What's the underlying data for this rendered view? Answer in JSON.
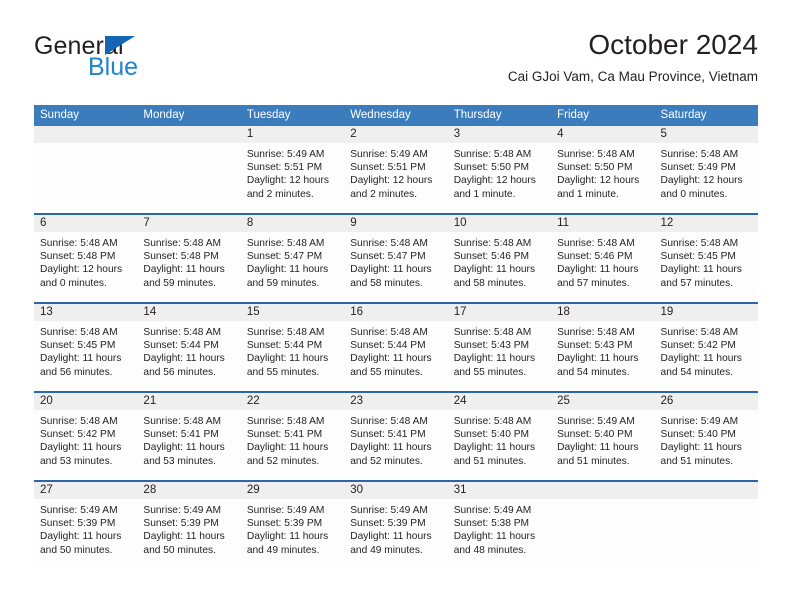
{
  "brand": {
    "line1": "General",
    "line2": "Blue",
    "triangle_color": "#1565b5",
    "blue_color": "#2283c8"
  },
  "header": {
    "title": "October 2024",
    "subtitle": "Cai GJoi Vam, Ca Mau Province, Vietnam"
  },
  "theme": {
    "header_row_bg": "#3b7cbd",
    "week_divider": "#2c68a8",
    "day_head_bg": "#efefef",
    "cell_bg": "#fdfdfd"
  },
  "weekdays": [
    "Sunday",
    "Monday",
    "Tuesday",
    "Wednesday",
    "Thursday",
    "Friday",
    "Saturday"
  ],
  "weeks": [
    [
      {
        "day": "",
        "lines": []
      },
      {
        "day": "",
        "lines": []
      },
      {
        "day": "1",
        "lines": [
          "Sunrise: 5:49 AM",
          "Sunset: 5:51 PM",
          "Daylight: 12 hours",
          "and 2 minutes."
        ]
      },
      {
        "day": "2",
        "lines": [
          "Sunrise: 5:49 AM",
          "Sunset: 5:51 PM",
          "Daylight: 12 hours",
          "and 2 minutes."
        ]
      },
      {
        "day": "3",
        "lines": [
          "Sunrise: 5:48 AM",
          "Sunset: 5:50 PM",
          "Daylight: 12 hours",
          "and 1 minute."
        ]
      },
      {
        "day": "4",
        "lines": [
          "Sunrise: 5:48 AM",
          "Sunset: 5:50 PM",
          "Daylight: 12 hours",
          "and 1 minute."
        ]
      },
      {
        "day": "5",
        "lines": [
          "Sunrise: 5:48 AM",
          "Sunset: 5:49 PM",
          "Daylight: 12 hours",
          "and 0 minutes."
        ]
      }
    ],
    [
      {
        "day": "6",
        "lines": [
          "Sunrise: 5:48 AM",
          "Sunset: 5:48 PM",
          "Daylight: 12 hours",
          "and 0 minutes."
        ]
      },
      {
        "day": "7",
        "lines": [
          "Sunrise: 5:48 AM",
          "Sunset: 5:48 PM",
          "Daylight: 11 hours",
          "and 59 minutes."
        ]
      },
      {
        "day": "8",
        "lines": [
          "Sunrise: 5:48 AM",
          "Sunset: 5:47 PM",
          "Daylight: 11 hours",
          "and 59 minutes."
        ]
      },
      {
        "day": "9",
        "lines": [
          "Sunrise: 5:48 AM",
          "Sunset: 5:47 PM",
          "Daylight: 11 hours",
          "and 58 minutes."
        ]
      },
      {
        "day": "10",
        "lines": [
          "Sunrise: 5:48 AM",
          "Sunset: 5:46 PM",
          "Daylight: 11 hours",
          "and 58 minutes."
        ]
      },
      {
        "day": "11",
        "lines": [
          "Sunrise: 5:48 AM",
          "Sunset: 5:46 PM",
          "Daylight: 11 hours",
          "and 57 minutes."
        ]
      },
      {
        "day": "12",
        "lines": [
          "Sunrise: 5:48 AM",
          "Sunset: 5:45 PM",
          "Daylight: 11 hours",
          "and 57 minutes."
        ]
      }
    ],
    [
      {
        "day": "13",
        "lines": [
          "Sunrise: 5:48 AM",
          "Sunset: 5:45 PM",
          "Daylight: 11 hours",
          "and 56 minutes."
        ]
      },
      {
        "day": "14",
        "lines": [
          "Sunrise: 5:48 AM",
          "Sunset: 5:44 PM",
          "Daylight: 11 hours",
          "and 56 minutes."
        ]
      },
      {
        "day": "15",
        "lines": [
          "Sunrise: 5:48 AM",
          "Sunset: 5:44 PM",
          "Daylight: 11 hours",
          "and 55 minutes."
        ]
      },
      {
        "day": "16",
        "lines": [
          "Sunrise: 5:48 AM",
          "Sunset: 5:44 PM",
          "Daylight: 11 hours",
          "and 55 minutes."
        ]
      },
      {
        "day": "17",
        "lines": [
          "Sunrise: 5:48 AM",
          "Sunset: 5:43 PM",
          "Daylight: 11 hours",
          "and 55 minutes."
        ]
      },
      {
        "day": "18",
        "lines": [
          "Sunrise: 5:48 AM",
          "Sunset: 5:43 PM",
          "Daylight: 11 hours",
          "and 54 minutes."
        ]
      },
      {
        "day": "19",
        "lines": [
          "Sunrise: 5:48 AM",
          "Sunset: 5:42 PM",
          "Daylight: 11 hours",
          "and 54 minutes."
        ]
      }
    ],
    [
      {
        "day": "20",
        "lines": [
          "Sunrise: 5:48 AM",
          "Sunset: 5:42 PM",
          "Daylight: 11 hours",
          "and 53 minutes."
        ]
      },
      {
        "day": "21",
        "lines": [
          "Sunrise: 5:48 AM",
          "Sunset: 5:41 PM",
          "Daylight: 11 hours",
          "and 53 minutes."
        ]
      },
      {
        "day": "22",
        "lines": [
          "Sunrise: 5:48 AM",
          "Sunset: 5:41 PM",
          "Daylight: 11 hours",
          "and 52 minutes."
        ]
      },
      {
        "day": "23",
        "lines": [
          "Sunrise: 5:48 AM",
          "Sunset: 5:41 PM",
          "Daylight: 11 hours",
          "and 52 minutes."
        ]
      },
      {
        "day": "24",
        "lines": [
          "Sunrise: 5:48 AM",
          "Sunset: 5:40 PM",
          "Daylight: 11 hours",
          "and 51 minutes."
        ]
      },
      {
        "day": "25",
        "lines": [
          "Sunrise: 5:49 AM",
          "Sunset: 5:40 PM",
          "Daylight: 11 hours",
          "and 51 minutes."
        ]
      },
      {
        "day": "26",
        "lines": [
          "Sunrise: 5:49 AM",
          "Sunset: 5:40 PM",
          "Daylight: 11 hours",
          "and 51 minutes."
        ]
      }
    ],
    [
      {
        "day": "27",
        "lines": [
          "Sunrise: 5:49 AM",
          "Sunset: 5:39 PM",
          "Daylight: 11 hours",
          "and 50 minutes."
        ]
      },
      {
        "day": "28",
        "lines": [
          "Sunrise: 5:49 AM",
          "Sunset: 5:39 PM",
          "Daylight: 11 hours",
          "and 50 minutes."
        ]
      },
      {
        "day": "29",
        "lines": [
          "Sunrise: 5:49 AM",
          "Sunset: 5:39 PM",
          "Daylight: 11 hours",
          "and 49 minutes."
        ]
      },
      {
        "day": "30",
        "lines": [
          "Sunrise: 5:49 AM",
          "Sunset: 5:39 PM",
          "Daylight: 11 hours",
          "and 49 minutes."
        ]
      },
      {
        "day": "31",
        "lines": [
          "Sunrise: 5:49 AM",
          "Sunset: 5:38 PM",
          "Daylight: 11 hours",
          "and 48 minutes."
        ]
      },
      {
        "day": "",
        "lines": []
      },
      {
        "day": "",
        "lines": []
      }
    ]
  ]
}
